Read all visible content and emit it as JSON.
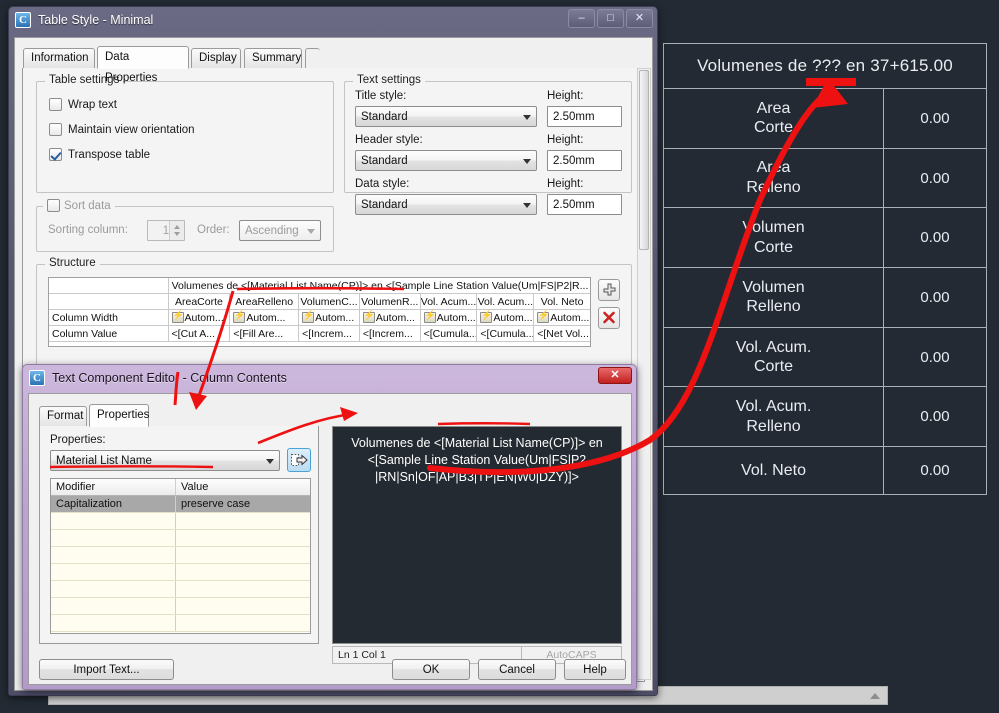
{
  "table_style_dialog": {
    "title": "Table Style - Minimal",
    "icon": "autocad-c-icon",
    "window_buttons": {
      "minimize": "–",
      "maximize": "□",
      "close": "✕"
    },
    "tabs": [
      {
        "label": "Information",
        "active": false
      },
      {
        "label": "Data Properties",
        "active": true
      },
      {
        "label": "Display",
        "active": false
      },
      {
        "label": "Summary",
        "active": false
      }
    ],
    "table_settings": {
      "group_title": "Table settings",
      "checkboxes": [
        {
          "label": "Wrap text",
          "checked": false
        },
        {
          "label": "Maintain view orientation",
          "checked": false
        },
        {
          "label": "Transpose table",
          "checked": true
        }
      ]
    },
    "sort_data": {
      "group_title": "Sort data",
      "enabled": false,
      "sorting_column_label": "Sorting column:",
      "sorting_column_value": "1",
      "order_label": "Order:",
      "order_value": "Ascending"
    },
    "text_settings": {
      "group_title": "Text settings",
      "rows": [
        {
          "style_label": "Title style:",
          "style_value": "Standard",
          "height_label": "Height:",
          "height_value": "2.50mm"
        },
        {
          "style_label": "Header style:",
          "style_value": "Standard",
          "height_label": "Height:",
          "height_value": "2.50mm"
        },
        {
          "style_label": "Data style:",
          "style_value": "Standard",
          "height_label": "Height:",
          "height_value": "2.50mm"
        }
      ]
    },
    "structure": {
      "group_title": "Structure",
      "title_row_text": "Volumenes de <[Material List Name(CP)]> en <[Sample Line Station Value(Um|FS|P2|R...",
      "column_headers": [
        "AreaCorte",
        "AreaRelleno",
        "VolumenC...",
        "VolumenR...",
        "Vol. Acum...",
        "Vol. Acum...",
        "Vol. Neto"
      ],
      "row_labels": [
        "Column Width",
        "Column Value"
      ],
      "column_width_values": [
        "Autom...",
        "Autom...",
        "Autom...",
        "Autom...",
        "Autom...",
        "Autom...",
        "Autom..."
      ],
      "column_value_values": [
        "<[Cut A...",
        "<[Fill Are...",
        "<[Increm...",
        "<[Increm...",
        "<[Cumula...",
        "<[Cumula...",
        "<[Net Vol..."
      ],
      "add_button": "+",
      "delete_button": "✖"
    }
  },
  "text_component_editor": {
    "title": "Text Component Editor - Column Contents",
    "icon": "autocad-c-icon",
    "close_button": "✕",
    "tabs": [
      {
        "label": "Format",
        "active": false
      },
      {
        "label": "Properties",
        "active": true
      }
    ],
    "properties_label": "Properties:",
    "properties_value": "Material List Name",
    "insert_button_icon": "insert-arrow-icon",
    "modifier_table": {
      "headers": [
        "Modifier",
        "Value"
      ],
      "rows": [
        {
          "modifier": "Capitalization",
          "value": "preserve case",
          "selected": true
        }
      ]
    },
    "editor_text": "Volumenes de <[Material List Name(CP)]> en <[Sample Line Station Value(Um|FS|P2|RN|Sn|OF|AP|B3|TP|EN|W0|DZY)]>",
    "editor_lines": [
      "Volumenes de <[Material List Name(CP)]> en",
      "<[Sample Line Station Value(Um|FS|P2",
      "|RN|Sn|OF|AP|B3|TP|EN|W0|DZY)]>"
    ],
    "status": {
      "position": "Ln 1 Col 1",
      "autocaps": "AutoCAPS"
    },
    "buttons": {
      "import_text": "Import Text...",
      "ok": "OK",
      "cancel": "Cancel",
      "help": "Help"
    }
  },
  "cad_preview_table": {
    "title": "Volumenes de ??? en 37+615.00",
    "rows": [
      {
        "label_line1": "Area",
        "label_line2": "Corte",
        "value": "0.00"
      },
      {
        "label_line1": "Area",
        "label_line2": "Relleno",
        "value": "0.00"
      },
      {
        "label_line1": "Volumen",
        "label_line2": "Corte",
        "value": "0.00"
      },
      {
        "label_line1": "Volumen",
        "label_line2": "Relleno",
        "value": "0.00"
      },
      {
        "label_line1": "Vol. Acum.",
        "label_line2": "Corte",
        "value": "0.00"
      },
      {
        "label_line1": "Vol. Acum.",
        "label_line2": "Relleno",
        "value": "0.00"
      },
      {
        "label_line1": "Vol. Neto",
        "label_line2": "",
        "value": "0.00"
      }
    ]
  },
  "annotations": {
    "color": "#ee1111"
  }
}
